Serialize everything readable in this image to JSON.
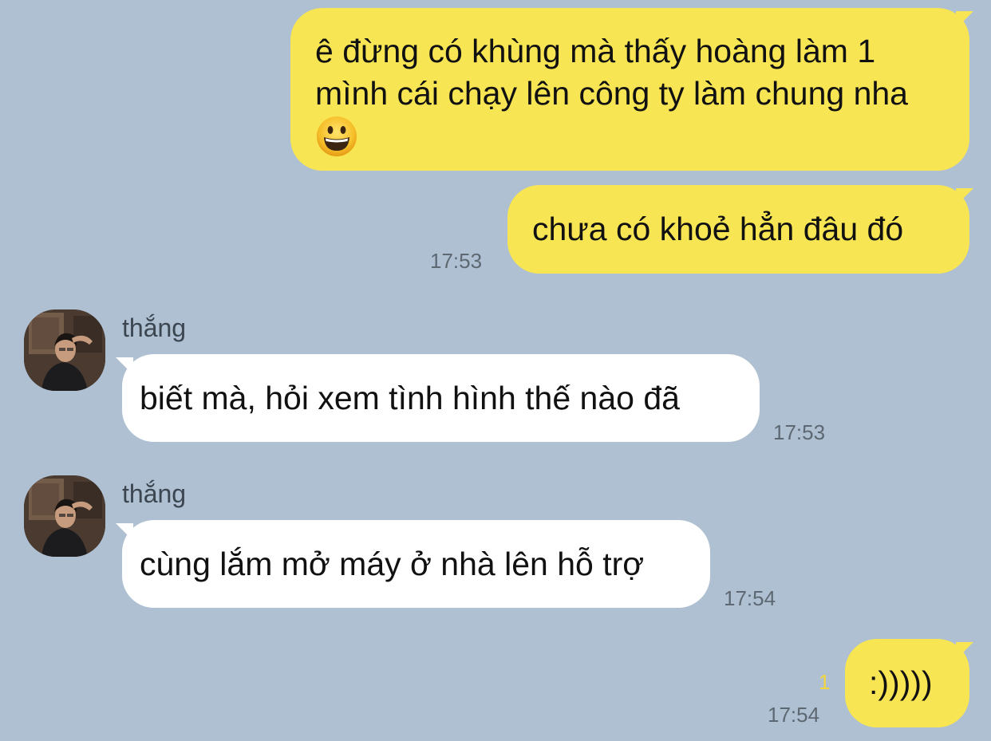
{
  "colors": {
    "background": "#aec0d1",
    "outgoing_bubble": "#f8e553",
    "incoming_bubble": "#ffffff",
    "unread_indicator": "#f4d63f"
  },
  "messages": [
    {
      "direction": "outgoing",
      "text": "ê đừng có khùng mà thấy hoàng làm 1 mình cái chạy lên công ty làm chung nha",
      "emoji": "grinning-face-icon"
    },
    {
      "direction": "outgoing",
      "text": "chưa có khoẻ hẳn đâu đó",
      "time": "17:53"
    },
    {
      "direction": "incoming",
      "sender": "thắng",
      "text": "biết mà, hỏi xem tình hình thế nào đã",
      "time": "17:53"
    },
    {
      "direction": "incoming",
      "sender": "thắng",
      "text": "cùng lắm mở máy ở nhà lên hỗ trợ",
      "time": "17:54"
    },
    {
      "direction": "outgoing",
      "text": ":)))))",
      "time": "17:54",
      "unread_count": "1"
    }
  ]
}
